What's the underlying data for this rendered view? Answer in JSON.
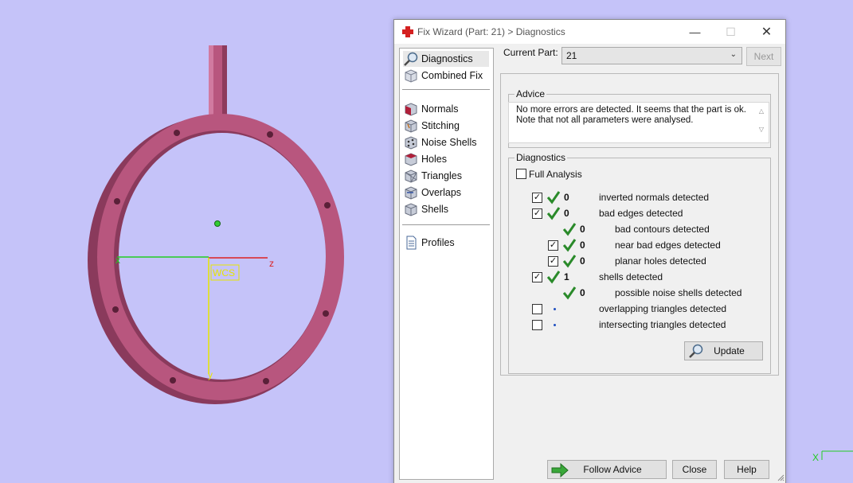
{
  "dialog": {
    "title": "Fix Wizard (Part: 21) > Diagnostics",
    "window_controls": {
      "minimize": "—",
      "maximize": "☐",
      "close": "✕"
    }
  },
  "nav": {
    "items": [
      {
        "label": "Diagnostics",
        "icon": "magnifier-icon"
      },
      {
        "label": "Combined Fix",
        "icon": "cube-icon"
      },
      {
        "label": "Normals",
        "icon": "normals-cube-icon"
      },
      {
        "label": "Stitching",
        "icon": "stitching-cube-icon"
      },
      {
        "label": "Noise Shells",
        "icon": "noise-shells-icon"
      },
      {
        "label": "Holes",
        "icon": "holes-cube-icon"
      },
      {
        "label": "Triangles",
        "icon": "triangles-cube-icon"
      },
      {
        "label": "Overlaps",
        "icon": "overlaps-cube-icon"
      },
      {
        "label": "Shells",
        "icon": "shells-cube-icon"
      },
      {
        "label": "Profiles",
        "icon": "document-icon"
      }
    ]
  },
  "current_part": {
    "label": "Current Part:",
    "value": "21"
  },
  "next_label": "Next",
  "advice": {
    "title": "Advice",
    "text": "No more errors are detected. It seems that the part is ok. Note that not all parameters were analysed."
  },
  "diagnostics": {
    "title": "Diagnostics",
    "full_analysis": "Full Analysis",
    "rows": [
      {
        "count": "0",
        "label": "inverted normals detected"
      },
      {
        "count": "0",
        "label": "bad edges detected"
      },
      {
        "count": "0",
        "label": "bad contours detected"
      },
      {
        "count": "0",
        "label": "near bad edges detected"
      },
      {
        "count": "0",
        "label": "planar holes detected"
      },
      {
        "count": "1",
        "label": "shells detected"
      },
      {
        "count": "0",
        "label": "possible noise shells detected"
      },
      {
        "count": "",
        "label": "overlapping triangles detected"
      },
      {
        "count": "",
        "label": "intersecting triangles detected"
      }
    ],
    "update_label": "Update"
  },
  "footer": {
    "follow_advice": "Follow Advice",
    "close": "Close",
    "help": "Help"
  },
  "viewport": {
    "axis_x": "x",
    "axis_y": "y",
    "axis_z": "z",
    "wcs": "WCS",
    "mini_axis_x": "X"
  },
  "colors": {
    "background": "#c5c3f9",
    "part": "#b8567e",
    "check_green": "#2a8a2a"
  }
}
